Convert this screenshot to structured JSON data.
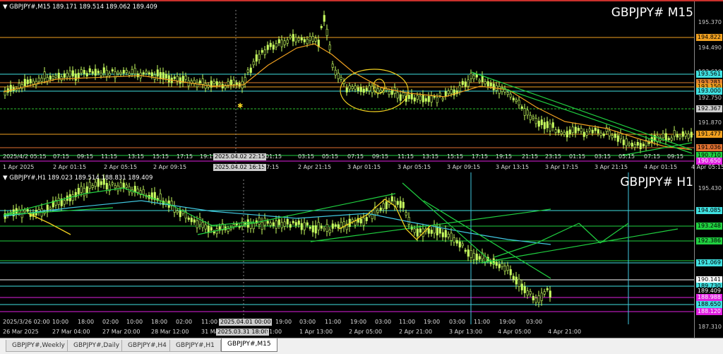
{
  "top_chart": {
    "info": "▼ GBPJPY#,M15  189.171 189.514 189.062 189.409",
    "title": "GBPJPY# M15",
    "price_ticks": [
      "195.370",
      "194.490",
      "193.610",
      "192.750",
      "191.870"
    ],
    "price_labels": [
      {
        "text": "194.822",
        "bg": "#f0a020",
        "fg": "#000"
      },
      {
        "text": "193.561",
        "bg": "#40e0e0",
        "fg": "#000"
      },
      {
        "text": "193.281",
        "bg": "#e08030",
        "fg": "#000"
      },
      {
        "text": "193.150",
        "bg": "#f0a020",
        "fg": "#000"
      },
      {
        "text": "193.000",
        "bg": "#40e0e0",
        "fg": "#000"
      },
      {
        "text": "192.367",
        "bg": "#cccccc",
        "fg": "#000"
      },
      {
        "text": "191.477",
        "bg": "#f0a020",
        "fg": "#000"
      },
      {
        "text": "191.036",
        "bg": "#e07030",
        "fg": "#000"
      },
      {
        "text": "190.710",
        "bg": "#20d040",
        "fg": "#000"
      },
      {
        "text": "190.650",
        "bg": "#e020e0",
        "fg": "#fff"
      }
    ],
    "time_row1": [
      "2025/4/2 05:15",
      "07:15",
      "09:15",
      "11:15",
      "13:15",
      "15:15",
      "17:15",
      "19:15",
      "01:15",
      "03:15",
      "05:15",
      "07:15",
      "09:15",
      "11:15",
      "13:15",
      "15:15",
      "17:15",
      "19:15",
      "21:15",
      "23:15",
      "01:15",
      "03:15",
      "05:15",
      "07:15",
      "09:15"
    ],
    "time_row1_box": "2025.04.02 22:15",
    "time_row2": [
      "1 Apr 2025",
      "2 Apr 01:15",
      "2 Apr 05:15",
      "2 Apr 09:15",
      "2 Apr 21:15",
      "3 Apr 01:15",
      "3 Apr 05:15",
      "3 Apr 09:15",
      "3 Apr 13:15",
      "3 Apr 17:15",
      "3 Apr 21:15",
      "4 Apr 01:15",
      "4 Apr 05:15"
    ],
    "time_row2_box": "2025.04.02 16:15",
    "time_row2_after": "17:15"
  },
  "bottom_chart": {
    "info": "▼ GBPJPY#,H1  189.023 189.514 188.831 189.409",
    "title": "GBPJPY# H1",
    "price_ticks": [
      "195.430",
      "187.310"
    ],
    "price_labels": [
      {
        "text": "194.085",
        "bg": "#40e0e0",
        "fg": "#000"
      },
      {
        "text": "193.248",
        "bg": "#20d040",
        "fg": "#000"
      },
      {
        "text": "192.386",
        "bg": "#20d040",
        "fg": "#000"
      },
      {
        "text": "191.069",
        "bg": "#40e0e0",
        "fg": "#000"
      },
      {
        "text": "190.141",
        "bg": "#ffffff",
        "fg": "#000"
      },
      {
        "text": "189.730",
        "bg": "#40e0e0",
        "fg": "#000"
      },
      {
        "text": "189.409",
        "bg": "#000000",
        "fg": "#fff"
      },
      {
        "text": "188.988",
        "bg": "#e020e0",
        "fg": "#fff"
      },
      {
        "text": "188.650",
        "bg": "#40e0e0",
        "fg": "#000"
      },
      {
        "text": "188.120",
        "bg": "#e020e0",
        "fg": "#fff"
      }
    ],
    "time_row1": [
      "2025/3/26 02:00",
      "10:00",
      "18:00",
      "02:00",
      "10:00",
      "18:00",
      "02:00",
      "11:00",
      "19:00",
      "03:00",
      "11:00",
      "19:00",
      "03:00",
      "11:00",
      "19:00",
      "03:00",
      "11:00",
      "19:00",
      "03:00"
    ],
    "time_row1_box": "2025.04.01 00:00",
    "time_row2": [
      "26 Mar 2025",
      "27 Mar 04:00",
      "27 Mar 20:00",
      "28 Mar 12:00",
      "31 Mar",
      "1 Apr 13:00",
      "2 Apr 05:00",
      "2 Apr 21:00",
      "3 Apr 13:00",
      "4 Apr 05:00",
      "4 Apr 21:00"
    ],
    "time_row2_box": "2025.03.31 18:00",
    "time_row2_after": "21:00"
  },
  "tabs": [
    "GBPJPY#,Weekly",
    "GBPJPY#,Daily",
    "GBPJPY#,H4",
    "GBPJPY#,H1",
    "GBPJPY#,M15"
  ],
  "active_tab": "GBPJPY#,M15",
  "colors": {
    "candle": "#c8ff60",
    "ma_orange": "#f0a020",
    "ma_cyan": "#40c8e0",
    "trend": "#20d040",
    "annotation": "#f0d020"
  }
}
